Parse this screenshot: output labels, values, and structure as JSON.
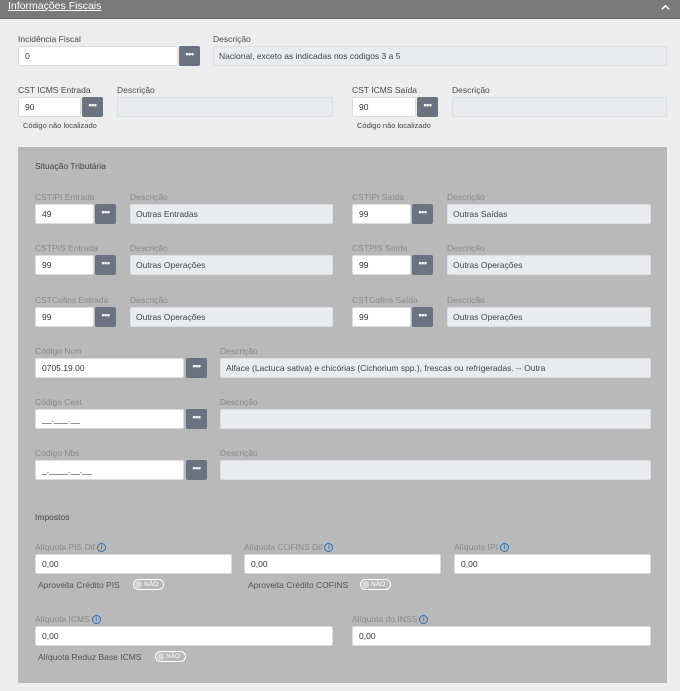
{
  "header": {
    "title": "Informações Fiscais"
  },
  "incidencia": {
    "label": "Incidência Fiscal",
    "value": "0",
    "desc_label": "Descrição",
    "desc_value": "Nacional, exceto as indicadas nos codigos 3 a 5"
  },
  "cst_entrada": {
    "label": "CST ICMS Entrada",
    "value": "90",
    "desc_label": "Descrição",
    "desc_value": "",
    "note": "Código não localizado"
  },
  "cst_saida": {
    "label": "CST ICMS Saída",
    "value": "90",
    "desc_label": "Descrição",
    "desc_value": "",
    "note": "Código não localizado"
  },
  "situacao": {
    "title": "Situação Tributária",
    "ipi_ent": {
      "label": "CSTIPI Entrada",
      "value": "49",
      "desc_label": "Descrição",
      "desc_value": "Outras Entradas"
    },
    "ipi_sai": {
      "label": "CSTIPI Saída",
      "value": "99",
      "desc_label": "Descrição",
      "desc_value": "Outras Saídas"
    },
    "pis_ent": {
      "label": "CSTPIS Entrada",
      "value": "99",
      "desc_label": "Descrição",
      "desc_value": "Outras Operações"
    },
    "pis_sai": {
      "label": "CSTPIS Saída",
      "value": "99",
      "desc_label": "Descrição",
      "desc_value": "Outras Operações"
    },
    "cof_ent": {
      "label": "CSTCofins Entrada",
      "value": "99",
      "desc_label": "Descrição",
      "desc_value": "Outras Operações"
    },
    "cof_sai": {
      "label": "CSTCofins Saída",
      "value": "99",
      "desc_label": "Descrição",
      "desc_value": "Outras Operações"
    },
    "ncm": {
      "label": "Código Ncm",
      "value": "0705.19.00",
      "desc_label": "Descrição",
      "desc_value": "Alface (Lactuca sativa) e chicórias (Cichorium spp.), frescas ou refrigeradas. -- Outra"
    },
    "cest": {
      "label": "Código Cest",
      "value": "__.___.__",
      "desc_label": "Descrição",
      "desc_value": ""
    },
    "nbs": {
      "label": "Código Nbs",
      "value": "_.____.__.__",
      "desc_label": "Descrição",
      "desc_value": ""
    }
  },
  "impostos": {
    "title": "Impostos",
    "pis": {
      "label": "Alíquota PIS Dif",
      "value": "0,00",
      "toggle_label": "Aproveita Crédito PIS",
      "toggle_text": "NÃO"
    },
    "cofins": {
      "label": "Alíquota COFINS Dif",
      "value": "0,00",
      "toggle_label": "Aproveita Crédito COFINS",
      "toggle_text": "NÃO"
    },
    "ipi": {
      "label": "Alíquota IPI",
      "value": "0,00"
    },
    "icms": {
      "label": "Alíquota ICMS",
      "value": "0,00",
      "toggle_label": "Alíquota Reduz Base ICMS",
      "toggle_text": "NÃO"
    },
    "inss": {
      "label": "Alíquota do INSS",
      "value": "0,00"
    }
  },
  "icons": {
    "lookup": "ellipsis-icon",
    "info": "info-icon",
    "collapse": "chevron-up-icon"
  }
}
